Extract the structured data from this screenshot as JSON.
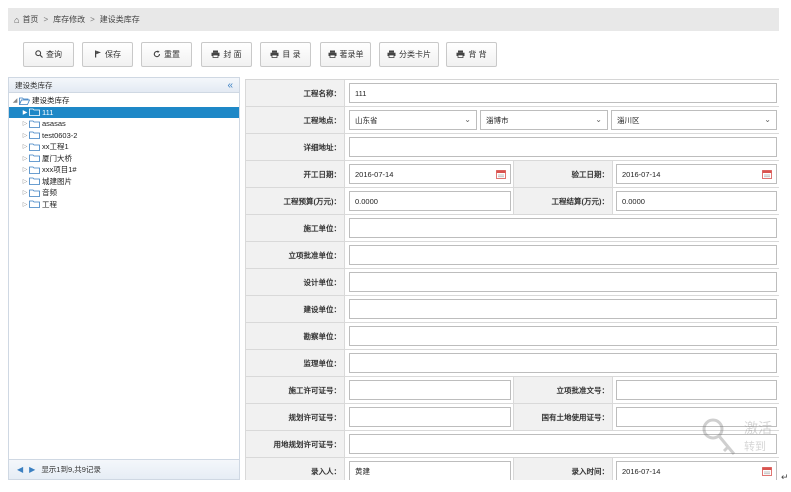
{
  "breadcrumb": {
    "home": "首页",
    "sep": ">",
    "item2": "库存修改",
    "item3": "建设类库存"
  },
  "toolbar": {
    "query": "查询",
    "save": "保存",
    "reset": "重置",
    "cover": "封 面",
    "catalog": "目 录",
    "register": "著录单",
    "category_card": "分类卡片",
    "back": "背 背"
  },
  "left_panel": {
    "title": "建设类库存",
    "root": "建设类库存",
    "items": [
      "111",
      "asasas",
      "test0603-2",
      "xx工程1",
      "厦门大桥",
      "xxx项目1#",
      "城建图片",
      "音频",
      "工程"
    ],
    "footer": "显示1到9,共9记录"
  },
  "form": {
    "project_name_label": "工程名称：",
    "project_name": "111",
    "location_label": "工程地点：",
    "province": "山东省",
    "city": "淄博市",
    "district": "淄川区",
    "address_label": "详细地址：",
    "address": "",
    "start_date_label": "开工日期：",
    "start_date": "2016-07-14",
    "accept_date_label": "验工日期：",
    "accept_date": "2016-07-14",
    "budget_label": "工程预算(万元)：",
    "budget": "0.0000",
    "settlement_label": "工程结算(万元)：",
    "settlement": "0.0000",
    "construction_unit_label": "施工单位：",
    "approval_unit_label": "立项批准单位：",
    "design_unit_label": "设计单位：",
    "builder_unit_label": "建设单位：",
    "survey_unit_label": "勘察单位：",
    "supervision_unit_label": "监理单位：",
    "construction_permit_label": "施工许可证号：",
    "approval_doc_label": "立项批准文号：",
    "planning_permit_label": "规划许可证号：",
    "land_use_cert_label": "国有土地使用证号：",
    "land_planning_permit_label": "用地规划许可证号：",
    "entered_by_label": "录入人：",
    "entered_by": "黄建",
    "entry_time_label": "录入时间：",
    "entry_time": "2016-07-14"
  },
  "watermark": {
    "line1": "激活",
    "line2": "转到"
  },
  "colors": {
    "selected": "#1e88c7",
    "accent": "#3a7fc1",
    "calendar": "#d9534f"
  }
}
